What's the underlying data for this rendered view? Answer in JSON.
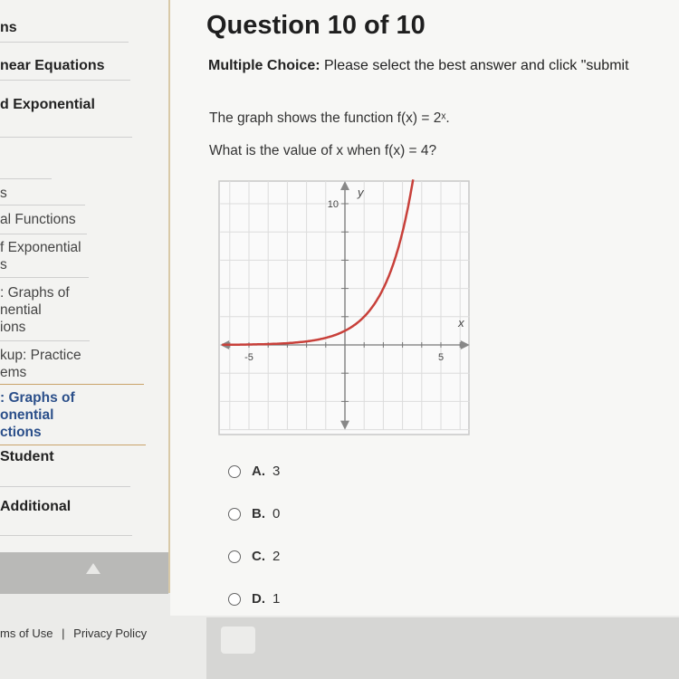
{
  "sidebar": {
    "items": [
      {
        "label": "ns",
        "style": "bold"
      },
      {
        "label": "near Equations",
        "style": "bold"
      },
      {
        "label": "d Exponential",
        "style": "bold"
      },
      {
        "label": "s",
        "style": "sub"
      },
      {
        "label": "al Functions",
        "style": "sub"
      },
      {
        "label": "f Exponential\ns",
        "style": "sub"
      },
      {
        "label": ": Graphs of\nnential\nions",
        "style": "sub"
      },
      {
        "label": "kup: Practice\nems",
        "style": "sub"
      },
      {
        "label": ": Graphs of\nonential\nctions",
        "style": "active"
      },
      {
        "label": "Student",
        "style": "bold"
      },
      {
        "label": "Additional",
        "style": "bold"
      }
    ]
  },
  "footer": {
    "terms": "ms of Use",
    "separator": "|",
    "privacy": "Privacy Policy"
  },
  "question": {
    "title": "Question 10 of 10",
    "instruction_label": "Multiple Choice:",
    "instruction_text": " Please select the best answer and click \"submit",
    "line1": "The graph shows the function f(x) = 2ˣ.",
    "line2": "What is the value of x when f(x) = 4?"
  },
  "chart_data": {
    "type": "line",
    "function": "f(x) = 2^x",
    "xlabel": "x",
    "ylabel": "y",
    "xlim": [
      -6.5,
      6.5
    ],
    "ylim": [
      -6,
      11.6
    ],
    "x_tick_labels": [
      "-5",
      "5"
    ],
    "y_tick_labels": [
      "10"
    ],
    "grid": true,
    "curve_color": "#c8403a",
    "x": [
      -6.5,
      -5,
      -4,
      -3,
      -2,
      -1,
      0,
      1,
      2,
      3,
      3.5
    ],
    "y": [
      0.011,
      0.031,
      0.063,
      0.125,
      0.25,
      0.5,
      1,
      2,
      4,
      8,
      11.3
    ]
  },
  "choices": [
    {
      "letter": "A.",
      "value": "3"
    },
    {
      "letter": "B.",
      "value": "0"
    },
    {
      "letter": "C.",
      "value": "2"
    },
    {
      "letter": "D.",
      "value": "1"
    }
  ]
}
